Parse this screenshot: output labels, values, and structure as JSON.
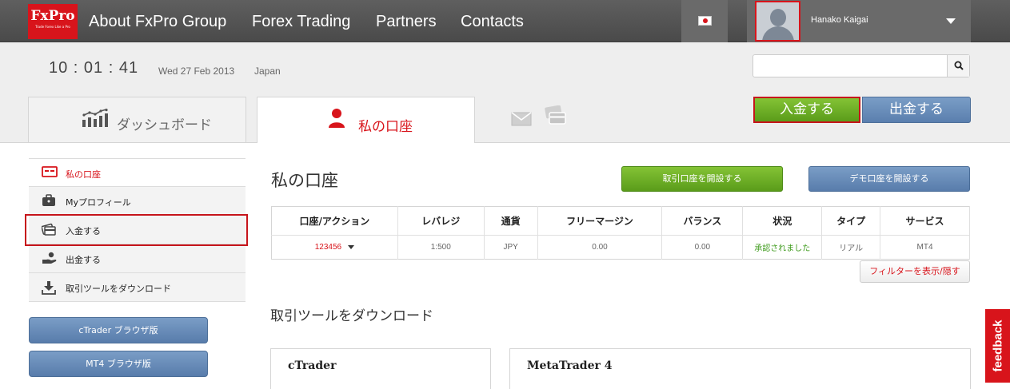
{
  "brand": {
    "logo": "FxPro",
    "tagline": "Trade Forex Like a Pro",
    "accent": "#d8141b"
  },
  "nav": {
    "items": [
      {
        "label": "About FxPro Group"
      },
      {
        "label": "Forex Trading"
      },
      {
        "label": "Partners"
      },
      {
        "label": "Contacts"
      }
    ]
  },
  "user": {
    "name": "Hanako Kaigai",
    "flag": "japan-flag-icon"
  },
  "info": {
    "time": "10 : 01 : 41",
    "date": "Wed 27 Feb 2013",
    "region": "Japan"
  },
  "search": {
    "value": "",
    "placeholder": ""
  },
  "tabs": {
    "dashboard": "ダッシュボード",
    "account": "私の口座"
  },
  "actions": {
    "deposit": "入金する",
    "withdraw": "出金する"
  },
  "sidebar": {
    "items": [
      {
        "label": "私の口座",
        "icon": "account-icon"
      },
      {
        "label": "Myプロフィール",
        "icon": "briefcase-icon"
      },
      {
        "label": "入金する",
        "icon": "wallet-icon"
      },
      {
        "label": "出金する",
        "icon": "hand-coin-icon"
      },
      {
        "label": "取引ツールをダウンロード",
        "icon": "download-icon"
      }
    ],
    "buttons": {
      "ctrader": "cTrader ブラウザ版",
      "mt4": "MT4 ブラウザ版"
    }
  },
  "main": {
    "title": "私の口座",
    "open_real": "取引口座を開設する",
    "open_demo": "デモ口座を開設する",
    "table": {
      "headers": [
        "口座/アクション",
        "レバレジ",
        "通貨",
        "フリーマージン",
        "バランス",
        "状況",
        "タイプ",
        "サービス"
      ],
      "rows": [
        {
          "account": "123456",
          "leverage": "1:500",
          "currency": "JPY",
          "free_margin": "0.00",
          "balance": "0.00",
          "status": "承認されました",
          "type": "リアル",
          "service": "MT4"
        }
      ]
    },
    "filter_button": "フィルターを表示/隠す",
    "download_title": "取引ツールをダウンロード",
    "panels": {
      "ctrader": "cTrader",
      "mt4": "MetaTrader 4"
    }
  },
  "feedback": "feedback"
}
